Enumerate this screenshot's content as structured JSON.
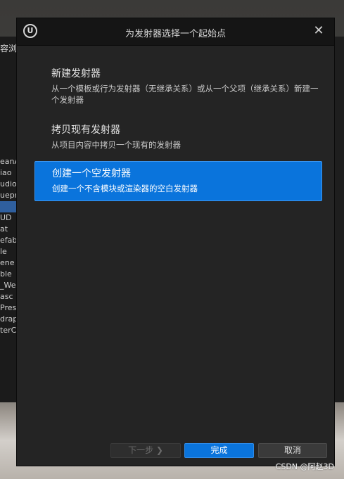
{
  "dialog": {
    "title": "为发射器选择一个起始点",
    "logo_text": "U",
    "close_glyph": "✕"
  },
  "options": [
    {
      "title": "新建发射器",
      "description": "从一个模板或行为发射器（无继承关系）或从一个父项（继承关系）新建一个发射器"
    },
    {
      "title": "拷贝现有发射器",
      "description": "从项目内容中拷贝一个现有的发射器"
    },
    {
      "title": "创建一个空发射器",
      "description": "创建一个不含模块或渲染器的空白发射器",
      "selected": true
    }
  ],
  "footer": {
    "next_label": "下一步 ❯",
    "finish_label": "完成",
    "cancel_label": "取消"
  },
  "background": {
    "panel_title": "容浏",
    "list_items": [
      "eanA",
      "iao",
      "udio",
      "uepr",
      "",
      "UD",
      "at",
      "efab",
      "le",
      "ene",
      "ble",
      "_We",
      "asc",
      "Pres",
      "drap",
      "terC"
    ],
    "selected_index": 4
  },
  "watermark": "CSDN @阿赵3D",
  "colors": {
    "accent": "#0a74dc",
    "dialog_bg": "#242424",
    "titlebar_bg": "#151515"
  }
}
